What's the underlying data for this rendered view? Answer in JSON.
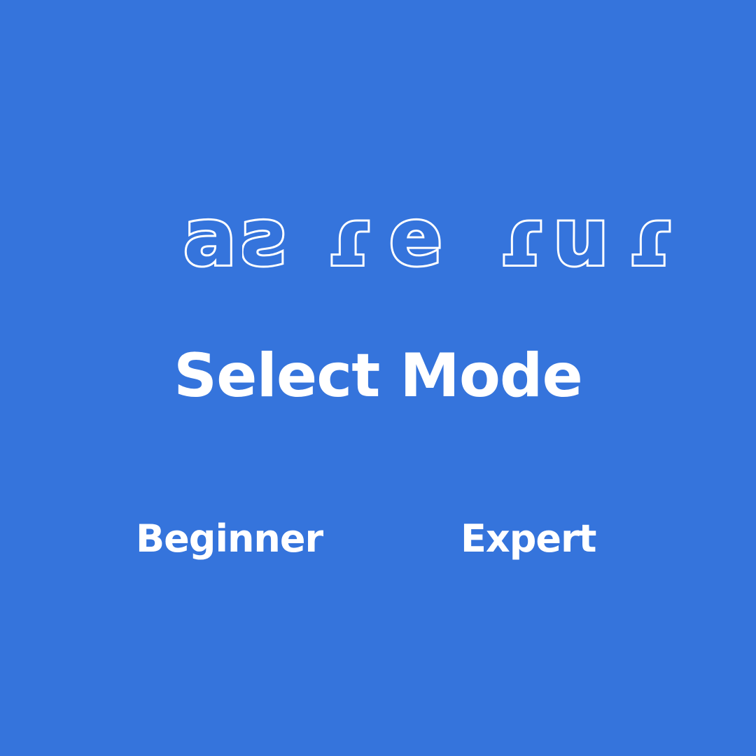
{
  "logo": {
    "chars": [
      "a",
      "ƨ",
      "ɾ",
      "e",
      "ɾ",
      "u",
      "ɾ"
    ]
  },
  "title": "Select Mode",
  "modes": [
    {
      "label": "Beginner"
    },
    {
      "label": "Expert"
    }
  ],
  "colors": {
    "background": "#3574dc",
    "text": "#ffffff"
  }
}
